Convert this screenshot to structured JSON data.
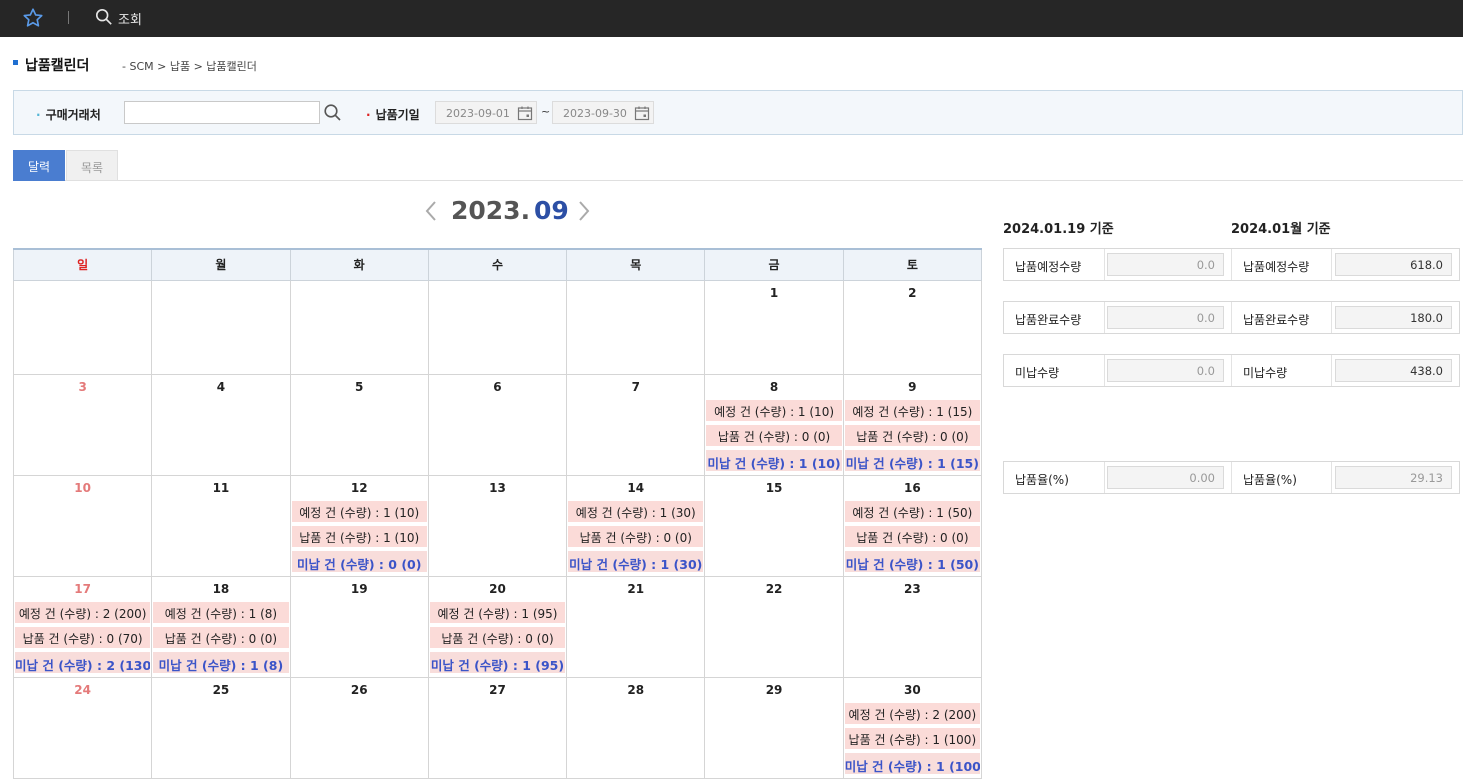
{
  "toolbar": {
    "search_label": "조회",
    "icons": [
      "star-icon",
      "search-icon"
    ]
  },
  "header": {
    "title": "납품캘린더",
    "breadcrumb": "- SCM > 납품 > 납품캘린더"
  },
  "search": {
    "vendor_label": "구매거래처",
    "vendor_value": "",
    "period_label": "납품기일",
    "date_from": "2023-09-01",
    "date_to": "2023-09-30",
    "tilde": "~"
  },
  "tabs": [
    {
      "label": "달력"
    },
    {
      "label": "목록"
    }
  ],
  "calendar": {
    "year": "2023.",
    "month": "09",
    "weekdays": [
      "일",
      "월",
      "화",
      "수",
      "목",
      "금",
      "토"
    ],
    "weeks": [
      [
        {
          "day": ""
        },
        {
          "day": ""
        },
        {
          "day": ""
        },
        {
          "day": ""
        },
        {
          "day": ""
        },
        {
          "day": "1"
        },
        {
          "day": "2"
        }
      ],
      [
        {
          "day": "3"
        },
        {
          "day": "4"
        },
        {
          "day": "5"
        },
        {
          "day": "6"
        },
        {
          "day": "7"
        },
        {
          "day": "8",
          "events": [
            "예정 건 (수량) : 1 (10)",
            "납품 건 (수량) : 0 (0)",
            "미납 건 (수량) : 1 (10)"
          ]
        },
        {
          "day": "9",
          "events": [
            "예정 건 (수량) : 1 (15)",
            "납품 건 (수량) : 0 (0)",
            "미납 건 (수량) : 1 (15)"
          ]
        }
      ],
      [
        {
          "day": "10"
        },
        {
          "day": "11"
        },
        {
          "day": "12",
          "events": [
            "예정 건 (수량) : 1 (10)",
            "납품 건 (수량) : 1 (10)",
            "미납 건 (수량) : 0 (0)"
          ]
        },
        {
          "day": "13"
        },
        {
          "day": "14",
          "events": [
            "예정 건 (수량) : 1 (30)",
            "납품 건 (수량) : 0 (0)",
            "미납 건 (수량) : 1 (30)"
          ]
        },
        {
          "day": "15"
        },
        {
          "day": "16",
          "events": [
            "예정 건 (수량) : 1 (50)",
            "납품 건 (수량) : 0 (0)",
            "미납 건 (수량) : 1 (50)"
          ]
        }
      ],
      [
        {
          "day": "17",
          "events": [
            "예정 건 (수량) : 2 (200)",
            "납품 건 (수량) : 0 (70)",
            "미납 건 (수량) : 2 (130"
          ]
        },
        {
          "day": "18",
          "events": [
            "예정 건 (수량) : 1 (8)",
            "납품 건 (수량) : 0 (0)",
            "미납 건 (수량) : 1 (8)"
          ]
        },
        {
          "day": "19"
        },
        {
          "day": "20",
          "events": [
            "예정 건 (수량) : 1 (95)",
            "납품 건 (수량) : 0 (0)",
            "미납 건 (수량) : 1 (95)"
          ]
        },
        {
          "day": "21"
        },
        {
          "day": "22"
        },
        {
          "day": "23"
        }
      ],
      [
        {
          "day": "24"
        },
        {
          "day": "25"
        },
        {
          "day": "26"
        },
        {
          "day": "27"
        },
        {
          "day": "28"
        },
        {
          "day": "29"
        },
        {
          "day": "30",
          "events": [
            "예정 건 (수량) : 2 (200)",
            "납품 건 (수량) : 1 (100)",
            "미납 건 (수량) : 1 (100"
          ]
        }
      ]
    ]
  },
  "summary": {
    "left_header": "2024.01.19 기준",
    "right_header": "2024.01월 기준",
    "rows": [
      {
        "label": "납품예정수량",
        "left_value": "0.0",
        "right_label": "납품예정수량",
        "right_value": "618.0"
      },
      {
        "label": "납품완료수량",
        "left_value": "0.0",
        "right_label": "납품완료수량",
        "right_value": "180.0"
      },
      {
        "label": "미납수량",
        "left_value": "0.0",
        "right_label": "미납수량",
        "right_value": "438.0"
      },
      {
        "label": "납품율(%)",
        "left_value": "0.00",
        "right_label": "납품율(%)",
        "right_value": "29.13"
      }
    ]
  },
  "colors": {
    "accent": "#4a7dd0",
    "month_blue": "#2c4fa5",
    "sunday_red": "#d22222",
    "event_bg": "#fbdbd8",
    "undelivered_text": "#3b54c8"
  }
}
